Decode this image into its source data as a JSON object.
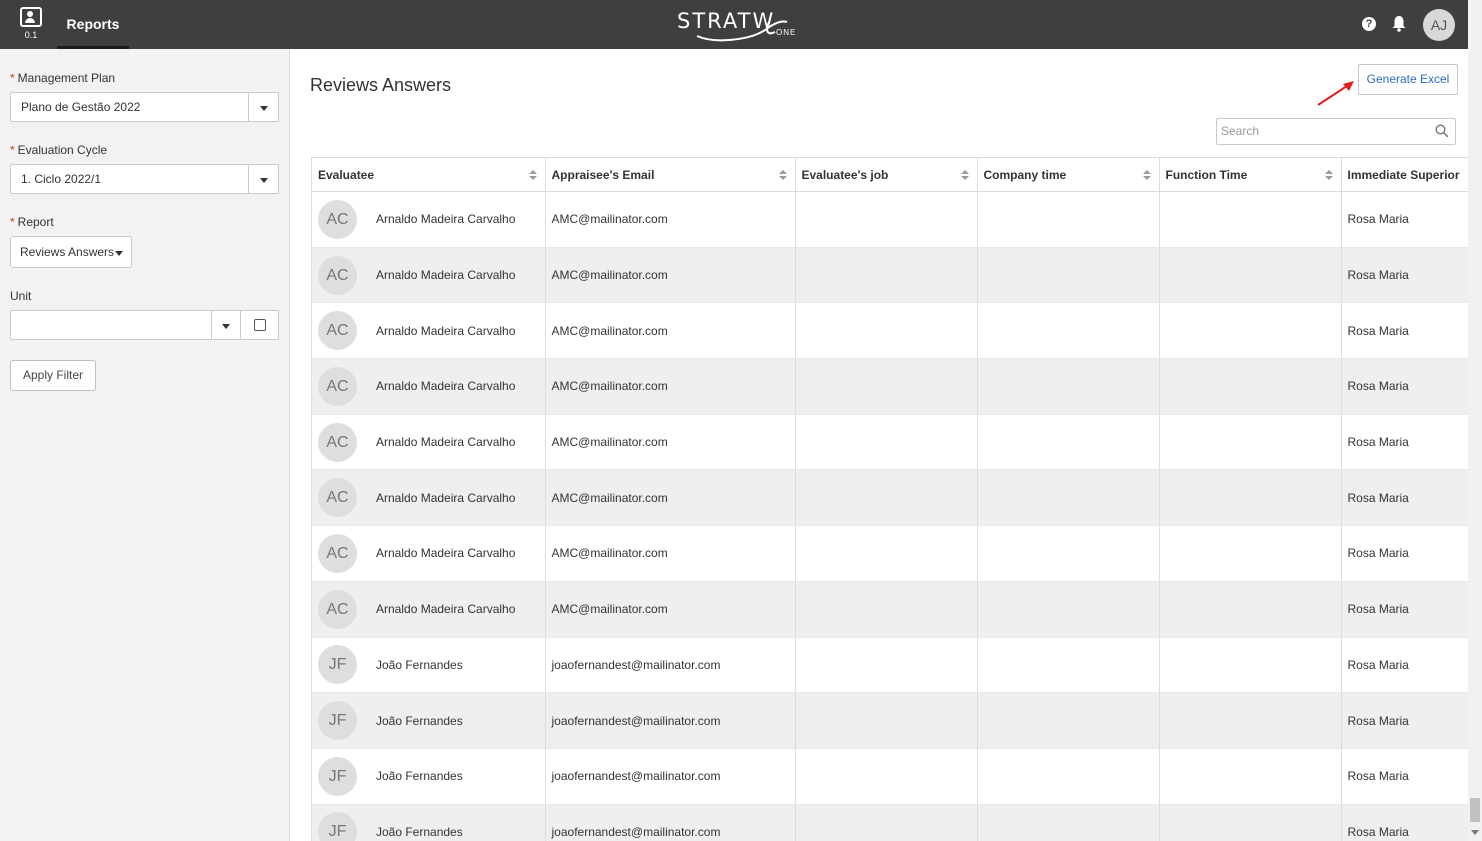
{
  "topbar": {
    "app_version": "0.1",
    "active_tab": "Reports",
    "logo_text": "STRATW",
    "logo_suffix": "ONE",
    "user_initials": "AJ",
    "help_glyph": "?"
  },
  "filters": {
    "management_plan": {
      "label": "Management Plan",
      "value": "Plano de Gestão 2022",
      "required": true
    },
    "evaluation_cycle": {
      "label": "Evaluation Cycle",
      "value": "1. Ciclo 2022/1",
      "required": true
    },
    "report": {
      "label": "Report",
      "value": "Reviews Answers",
      "required": true
    },
    "unit": {
      "label": "Unit",
      "value": ""
    },
    "apply_label": "Apply Filter",
    "required_mark": "*"
  },
  "main": {
    "title": "Reviews Answers",
    "generate_excel_label": "Generate Excel",
    "search_placeholder": "Search"
  },
  "table": {
    "columns": [
      "Evaluatee",
      "Appraisee's Email",
      "Evaluatee's job",
      "Company time",
      "Function Time",
      "Immediate Superior"
    ],
    "rows": [
      {
        "initials": "AC",
        "name": "Arnaldo Madeira Carvalho",
        "email": "AMC@mailinator.com",
        "job": "",
        "company_time": "",
        "function_time": "",
        "superior": "Rosa Maria"
      },
      {
        "initials": "AC",
        "name": "Arnaldo Madeira Carvalho",
        "email": "AMC@mailinator.com",
        "job": "",
        "company_time": "",
        "function_time": "",
        "superior": "Rosa Maria"
      },
      {
        "initials": "AC",
        "name": "Arnaldo Madeira Carvalho",
        "email": "AMC@mailinator.com",
        "job": "",
        "company_time": "",
        "function_time": "",
        "superior": "Rosa Maria"
      },
      {
        "initials": "AC",
        "name": "Arnaldo Madeira Carvalho",
        "email": "AMC@mailinator.com",
        "job": "",
        "company_time": "",
        "function_time": "",
        "superior": "Rosa Maria"
      },
      {
        "initials": "AC",
        "name": "Arnaldo Madeira Carvalho",
        "email": "AMC@mailinator.com",
        "job": "",
        "company_time": "",
        "function_time": "",
        "superior": "Rosa Maria"
      },
      {
        "initials": "AC",
        "name": "Arnaldo Madeira Carvalho",
        "email": "AMC@mailinator.com",
        "job": "",
        "company_time": "",
        "function_time": "",
        "superior": "Rosa Maria"
      },
      {
        "initials": "AC",
        "name": "Arnaldo Madeira Carvalho",
        "email": "AMC@mailinator.com",
        "job": "",
        "company_time": "",
        "function_time": "",
        "superior": "Rosa Maria"
      },
      {
        "initials": "AC",
        "name": "Arnaldo Madeira Carvalho",
        "email": "AMC@mailinator.com",
        "job": "",
        "company_time": "",
        "function_time": "",
        "superior": "Rosa Maria"
      },
      {
        "initials": "JF",
        "name": "João Fernandes",
        "email": "joaofernandest@mailinator.com",
        "job": "",
        "company_time": "",
        "function_time": "",
        "superior": "Rosa Maria"
      },
      {
        "initials": "JF",
        "name": "João Fernandes",
        "email": "joaofernandest@mailinator.com",
        "job": "",
        "company_time": "",
        "function_time": "",
        "superior": "Rosa Maria"
      },
      {
        "initials": "JF",
        "name": "João Fernandes",
        "email": "joaofernandest@mailinator.com",
        "job": "",
        "company_time": "",
        "function_time": "",
        "superior": "Rosa Maria"
      },
      {
        "initials": "JF",
        "name": "João Fernandes",
        "email": "joaofernandest@mailinator.com",
        "job": "",
        "company_time": "",
        "function_time": "",
        "superior": "Rosa Maria"
      }
    ]
  },
  "colors": {
    "topbar_bg": "#3f3f3f",
    "sidebar_bg": "#f2f2f2",
    "link_blue": "#2a6ebb",
    "required_red": "#d9342b",
    "annotation_arrow": "#e02020"
  },
  "icons": {
    "app": "user-card-icon",
    "help": "help-icon",
    "notifications": "bell-icon",
    "search": "search-icon",
    "dropdown": "chevron-down-icon",
    "sort": "sort-icon"
  }
}
